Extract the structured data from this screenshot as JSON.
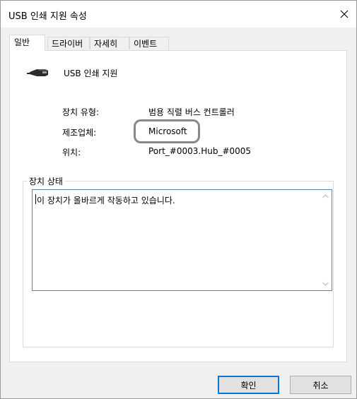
{
  "window": {
    "title": "USB 인쇄 지원 속성",
    "close_icon": "close-icon"
  },
  "tabs": [
    {
      "label": "일반",
      "active": true
    },
    {
      "label": "드라이버",
      "active": false
    },
    {
      "label": "자세히",
      "active": false
    },
    {
      "label": "이벤트",
      "active": false
    }
  ],
  "device": {
    "icon": "usb-plug-icon",
    "name": "USB 인쇄 지원"
  },
  "properties": [
    {
      "label": "장치 유형:",
      "value": "범용 직렬 버스 컨트롤러"
    },
    {
      "label": "제조업체:",
      "value": "Microsoft"
    },
    {
      "label": "위치:",
      "value": "Port_#0003.Hub_#0005"
    }
  ],
  "status_group": {
    "legend": "장치 상태",
    "text": "이 장치가 올바르게 작동하고 있습니다."
  },
  "buttons": {
    "ok": "확인",
    "cancel": "취소"
  },
  "colors": {
    "dialog_bg": "#f0f0f0",
    "panel_bg": "#ffffff",
    "focus_border": "#0078d7",
    "highlight_outline": "#888888"
  }
}
